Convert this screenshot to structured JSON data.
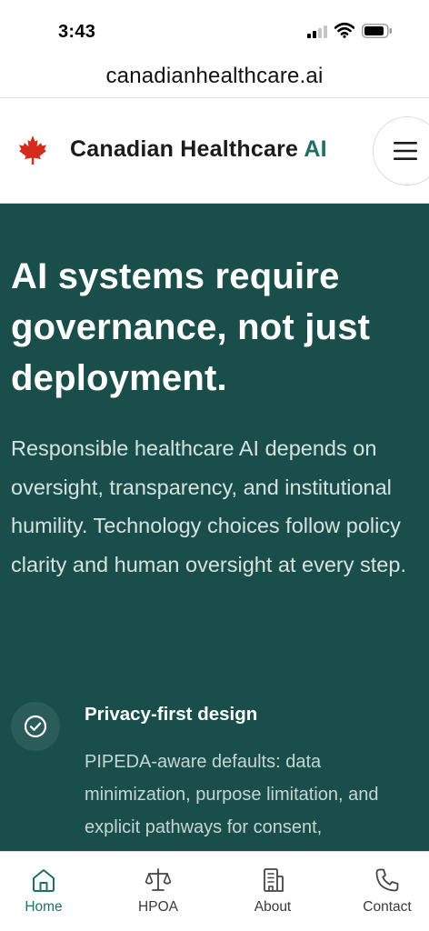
{
  "status_bar": {
    "time": "3:43",
    "icons": [
      "cellular-signal-icon",
      "wifi-icon",
      "battery-icon"
    ]
  },
  "browser": {
    "url": "canadianhealthcare.ai"
  },
  "header": {
    "logo_icon": "maple-leaf-icon",
    "brand_main": "Canadian Healthcare ",
    "brand_accent": "AI",
    "menu_icon": "hamburger-menu-icon"
  },
  "hero": {
    "title": "AI systems require governance, not just deployment.",
    "body": "Responsible healthcare AI depends on oversight, transparency, and institutional humility. Technology choices follow policy clarity and human oversight at every step.",
    "feature": {
      "icon": "check-circle-icon",
      "title": "Privacy-first design",
      "description": "PIPEDA-aware defaults: data minimization, purpose limitation, and explicit pathways for consent,"
    }
  },
  "bottom_nav": {
    "items": [
      {
        "label": "Home",
        "icon": "home-icon",
        "active": true
      },
      {
        "label": "HPOA",
        "icon": "scale-icon",
        "active": false
      },
      {
        "label": "About",
        "icon": "building-icon",
        "active": false
      },
      {
        "label": "Contact",
        "icon": "phone-icon",
        "active": false
      }
    ]
  },
  "colors": {
    "hero_background": "#1a4e4b",
    "accent": "#1f6f65",
    "maple_red": "#d52b1e"
  }
}
